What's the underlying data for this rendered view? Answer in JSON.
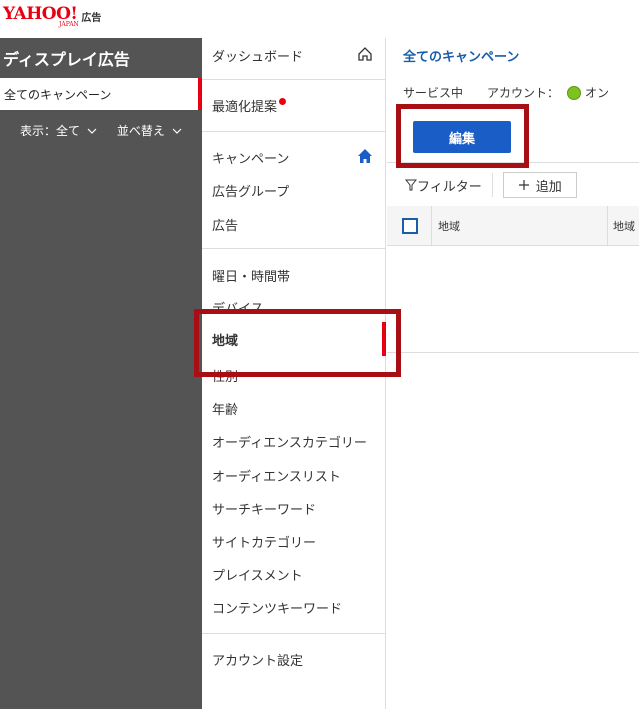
{
  "header": {
    "logo_text": "YAHOO!",
    "logo_sub": "JAPAN",
    "product": "広告"
  },
  "left_panel": {
    "title": "ディスプレイ広告",
    "selected_campaign": "全てのキャンペーン",
    "display_filter": "表示：全て",
    "sort": "並べ替え"
  },
  "nav": {
    "dashboard": "ダッシュボード",
    "optimization": "最適化提案",
    "campaign": "キャンペーン",
    "ad_group": "広告グループ",
    "ad": "広告",
    "day_time": "曜日・時間帯",
    "device": "デバイス",
    "region": "地域",
    "gender": "性別",
    "age": "年齢",
    "audience_category": "オーディエンスカテゴリー",
    "audience_list": "オーディエンスリスト",
    "search_keyword": "サーチキーワード",
    "site_category": "サイトカテゴリー",
    "placement": "プレイスメント",
    "content_keyword": "コンテンツキーワード",
    "account_settings": "アカウント設定"
  },
  "content": {
    "breadcrumb": "全てのキャンペーン",
    "service_status": "サービス中",
    "account_label": "アカウント：",
    "account_status": "オン",
    "edit_button": "編集",
    "filter_label": "フィルター",
    "add_label": "追加",
    "table_columns": [
      "地域",
      "地域"
    ]
  },
  "colors": {
    "brand_red": "#e60012",
    "primary_blue": "#1a5dc7",
    "highlight": "#a80f14",
    "status_green": "#7ec220"
  }
}
